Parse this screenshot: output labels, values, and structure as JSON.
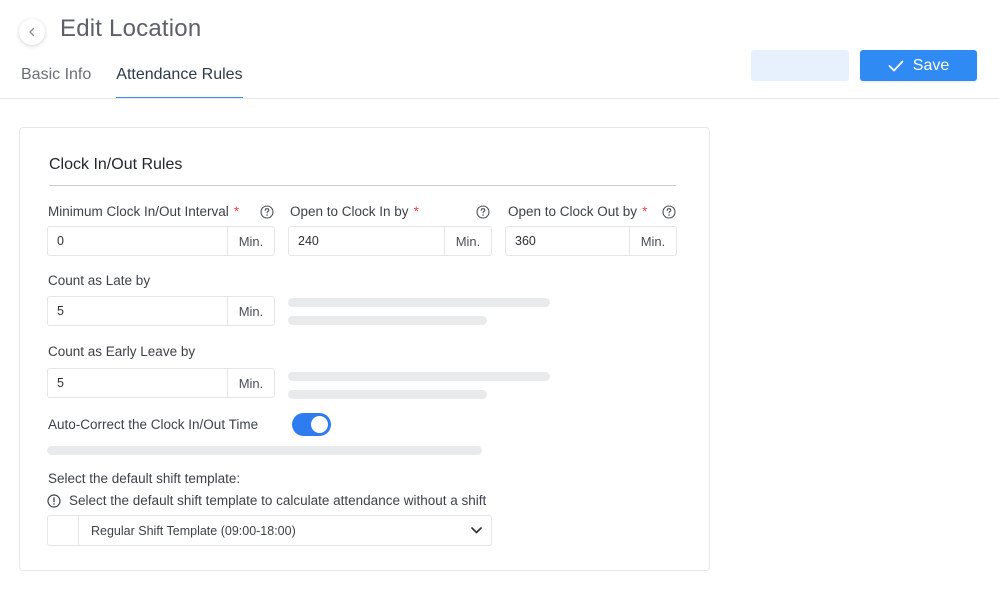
{
  "header": {
    "title": "Edit Location",
    "tabs": [
      {
        "label": "Basic Info",
        "active": false
      },
      {
        "label": "Attendance Rules",
        "active": true
      }
    ],
    "save_label": "Save"
  },
  "colors": {
    "primary": "#2f8bf3",
    "ghost_button": "#e6f1fd",
    "required": "#e5484d",
    "toggle_on": "#2f7cf0"
  },
  "icons": {
    "back": "chevron-left-icon",
    "save": "checkmark-icon",
    "help": "question-circle-icon",
    "info": "exclamation-circle-icon",
    "dropdown": "chevron-down-icon"
  },
  "card": {
    "title": "Clock In/Out Rules",
    "min_interval": {
      "label": "Minimum Clock In/Out Interval",
      "required": "*",
      "value": "0",
      "unit": "Min."
    },
    "open_clock_in": {
      "label": "Open to Clock In by",
      "required": "*",
      "value": "240",
      "unit": "Min."
    },
    "open_clock_out": {
      "label": "Open to Clock Out by",
      "required": "*",
      "value": "360",
      "unit": "Min."
    },
    "late": {
      "label": "Count as Late by",
      "value": "5",
      "unit": "Min."
    },
    "early_leave": {
      "label": "Count as Early Leave by",
      "value": "5",
      "unit": "Min."
    },
    "auto_correct": {
      "label": "Auto-Correct the Clock In/Out Time",
      "enabled": true
    },
    "shift_template": {
      "label": "Select the default shift template:",
      "info": "Select the default shift template to calculate attendance without a shift",
      "selected": "Regular Shift Template (09:00-18:00)"
    }
  }
}
